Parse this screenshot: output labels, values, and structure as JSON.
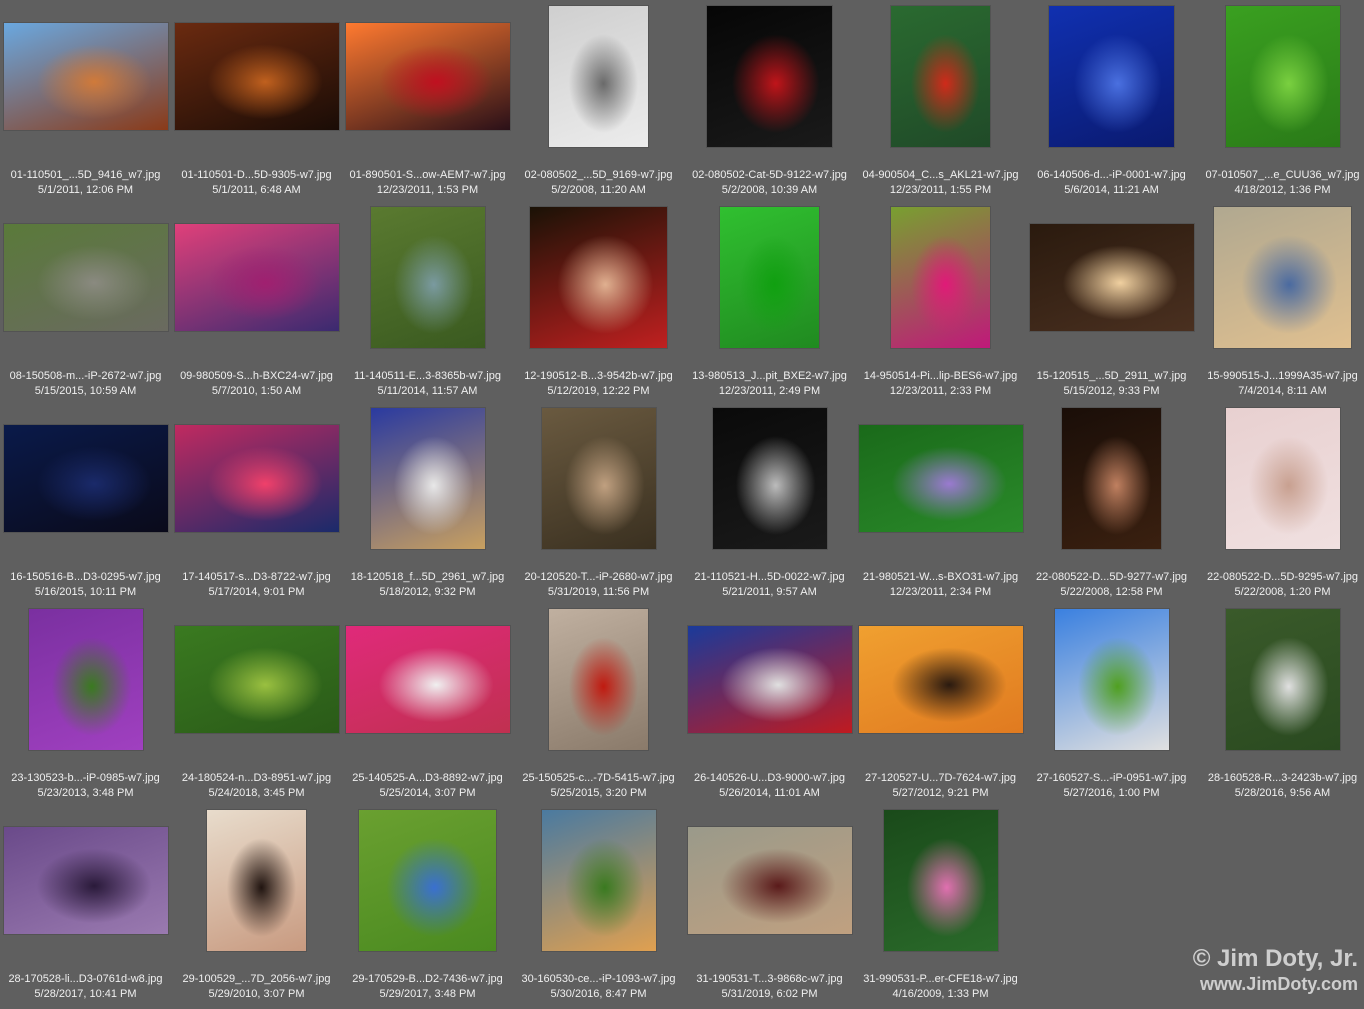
{
  "items": [
    {
      "name": "01-110501_...5D_9416_w7.jpg",
      "date": "5/1/2011, 12:06 PM",
      "shape": "l",
      "colors": [
        "#6aa8e0",
        "#d07a3a",
        "#8a3a18"
      ]
    },
    {
      "name": "01-110501-D...5D-9305-w7.jpg",
      "date": "5/1/2011, 6:48 AM",
      "shape": "l",
      "colors": [
        "#6a2a10",
        "#c0601e",
        "#1a0c06"
      ]
    },
    {
      "name": "01-890501-S...ow-AEM7-w7.jpg",
      "date": "12/23/2011, 1:53 PM",
      "shape": "l",
      "colors": [
        "#ff7a30",
        "#c01020",
        "#2a1018"
      ]
    },
    {
      "name": "02-080502_...5D_9169-w7.jpg",
      "date": "5/2/2008, 11:20 AM",
      "shape": "p",
      "colors": [
        "#cfcfcf",
        "#6a6a6a",
        "#ececec"
      ]
    },
    {
      "name": "02-080502-Cat-5D-9122-w7.jpg",
      "date": "5/2/2008, 10:39 AM",
      "shape": "s",
      "colors": [
        "#060606",
        "#c0141a",
        "#1a1a1a"
      ]
    },
    {
      "name": "04-900504_C...s_AKL21-w7.jpg",
      "date": "12/23/2011, 1:55 PM",
      "shape": "p",
      "colors": [
        "#2a6a30",
        "#d02a1a",
        "#204a28"
      ]
    },
    {
      "name": "06-140506-d...-iP-0001-w7.jpg",
      "date": "5/6/2014, 11:21 AM",
      "shape": "s",
      "colors": [
        "#1030b0",
        "#4a70e0",
        "#0a1a70"
      ]
    },
    {
      "name": "07-010507_...e_CUU36_w7.jpg",
      "date": "4/18/2012, 1:36 PM",
      "shape": "q",
      "colors": [
        "#3aa020",
        "#7ad040",
        "#2a7a18"
      ]
    },
    {
      "name": "08-150508-m...-iP-2672-w7.jpg",
      "date": "5/15/2015, 10:59 AM",
      "shape": "l",
      "colors": [
        "#5a7a3a",
        "#8a8a80",
        "#6a6a60"
      ]
    },
    {
      "name": "09-980509-S...h-BXC24-w7.jpg",
      "date": "5/7/2010, 1:50 AM",
      "shape": "l",
      "colors": [
        "#e0407a",
        "#a02070",
        "#3a2a70"
      ]
    },
    {
      "name": "11-140511-E...3-8365b-w7.jpg",
      "date": "5/11/2014, 11:57 AM",
      "shape": "q",
      "colors": [
        "#5a7a30",
        "#7a9aa0",
        "#3a5a20"
      ]
    },
    {
      "name": "12-190512-B...3-9542b-w7.jpg",
      "date": "5/12/2019, 12:22 PM",
      "shape": "r",
      "colors": [
        "#1a1206",
        "#e0b090",
        "#c02020"
      ]
    },
    {
      "name": "13-980513_J...pit_BXE2-w7.jpg",
      "date": "12/23/2011, 2:49 PM",
      "shape": "p",
      "colors": [
        "#30c030",
        "#10a010",
        "#208a20"
      ]
    },
    {
      "name": "14-950514-Pi...lip-BES6-w7.jpg",
      "date": "12/23/2011, 2:33 PM",
      "shape": "p",
      "colors": [
        "#78a030",
        "#e01a78",
        "#c0187a"
      ]
    },
    {
      "name": "15-120515_...5D_2911_w7.jpg",
      "date": "5/15/2012, 9:33 PM",
      "shape": "l",
      "colors": [
        "#2a1a0e",
        "#f0d0a0",
        "#4a3020"
      ]
    },
    {
      "name": "15-990515-J...1999A35-w7.jpg",
      "date": "7/4/2014, 8:11 AM",
      "shape": "r",
      "colors": [
        "#b0a890",
        "#4a6aa0",
        "#e0c090"
      ]
    },
    {
      "name": "16-150516-B...D3-0295-w7.jpg",
      "date": "5/16/2015, 10:11 PM",
      "shape": "l",
      "colors": [
        "#0a1a4a",
        "#1a2a6a",
        "#0a0a1a"
      ]
    },
    {
      "name": "17-140517-s...D3-8722-w7.jpg",
      "date": "5/17/2014, 9:01 PM",
      "shape": "l",
      "colors": [
        "#c02a60",
        "#f0406a",
        "#1a2a6a"
      ]
    },
    {
      "name": "18-120518_f...5D_2961_w7.jpg",
      "date": "5/18/2012, 9:32 PM",
      "shape": "q",
      "colors": [
        "#2a3aa0",
        "#e8e8e8",
        "#c8a060"
      ]
    },
    {
      "name": "20-120520-T...-iP-2680-w7.jpg",
      "date": "5/31/2019, 11:56 PM",
      "shape": "q",
      "colors": [
        "#6a5a40",
        "#c0a080",
        "#3a3020"
      ]
    },
    {
      "name": "21-110521-H...5D-0022-w7.jpg",
      "date": "5/21/2011, 9:57 AM",
      "shape": "q",
      "colors": [
        "#0a0a0a",
        "#bcbcbc",
        "#1a1a1a"
      ]
    },
    {
      "name": "21-980521-W...s-BXO31-w7.jpg",
      "date": "12/23/2011, 2:34 PM",
      "shape": "l",
      "colors": [
        "#1a6a1a",
        "#9a7ad0",
        "#2a8a2a"
      ]
    },
    {
      "name": "22-080522-D...5D-9277-w7.jpg",
      "date": "5/22/2008, 12:58 PM",
      "shape": "p",
      "colors": [
        "#1a0e08",
        "#c08060",
        "#3a2010"
      ]
    },
    {
      "name": "22-080522-D...5D-9295-w7.jpg",
      "date": "5/22/2008, 1:20 PM",
      "shape": "q",
      "colors": [
        "#e8d0d0",
        "#c8a090",
        "#f0e0e0"
      ]
    },
    {
      "name": "23-130523-b...-iP-0985-w7.jpg",
      "date": "5/23/2013, 3:48 PM",
      "shape": "q",
      "colors": [
        "#7a30a0",
        "#3a7a20",
        "#a040c0"
      ]
    },
    {
      "name": "24-180524-n...D3-8951-w7.jpg",
      "date": "5/24/2018, 3:45 PM",
      "shape": "l",
      "colors": [
        "#3a7a20",
        "#9ac040",
        "#2a5a18"
      ]
    },
    {
      "name": "25-140525-A...D3-8892-w7.jpg",
      "date": "5/25/2014, 3:07 PM",
      "shape": "l",
      "colors": [
        "#e02a7a",
        "#f0f0f0",
        "#c03050"
      ]
    },
    {
      "name": "25-150525-c...-7D-5415-w7.jpg",
      "date": "5/25/2015, 3:20 PM",
      "shape": "p",
      "colors": [
        "#c0b0a0",
        "#c01a10",
        "#8a7a6a"
      ]
    },
    {
      "name": "26-140526-U...D3-9000-w7.jpg",
      "date": "5/26/2014, 11:01 AM",
      "shape": "l",
      "colors": [
        "#1a3a9a",
        "#e0e0e0",
        "#c01a20"
      ]
    },
    {
      "name": "27-120527-U...7D-7624-w7.jpg",
      "date": "5/27/2012, 9:21 PM",
      "shape": "l",
      "colors": [
        "#f0a030",
        "#2a1a10",
        "#e07a20"
      ]
    },
    {
      "name": "27-160527-S...-iP-0951-w7.jpg",
      "date": "5/27/2016, 1:00 PM",
      "shape": "q",
      "colors": [
        "#3a80e0",
        "#50a020",
        "#e0e0e0"
      ]
    },
    {
      "name": "28-160528-R...3-2423b-w7.jpg",
      "date": "5/28/2016, 9:56 AM",
      "shape": "q",
      "colors": [
        "#3a5a2a",
        "#e0e0e0",
        "#2a4a20"
      ]
    },
    {
      "name": "28-170528-li...D3-0761d-w8.jpg",
      "date": "5/28/2017, 10:41 PM",
      "shape": "l",
      "colors": [
        "#6a4a8a",
        "#2a1a3a",
        "#9a7ab0"
      ]
    },
    {
      "name": "29-100529_...7D_2056-w7.jpg",
      "date": "5/29/2010, 3:07 PM",
      "shape": "p",
      "colors": [
        "#e8dccc",
        "#201410",
        "#c89a80"
      ]
    },
    {
      "name": "29-170529-B...D2-7436-w7.jpg",
      "date": "5/29/2017, 3:48 PM",
      "shape": "r",
      "colors": [
        "#6aa030",
        "#3a70d0",
        "#4a8a20"
      ]
    },
    {
      "name": "30-160530-ce...-iP-1093-w7.jpg",
      "date": "5/30/2016, 8:47 PM",
      "shape": "q",
      "colors": [
        "#4a7aa0",
        "#3a7a20",
        "#e0a050"
      ]
    },
    {
      "name": "31-190531-T...3-9868c-w7.jpg",
      "date": "5/31/2019, 6:02 PM",
      "shape": "l",
      "colors": [
        "#9a9a8a",
        "#5a1a1a",
        "#c0a080"
      ]
    },
    {
      "name": "31-990531-P...er-CFE18-w7.jpg",
      "date": "4/16/2009, 1:33 PM",
      "shape": "q",
      "colors": [
        "#1a4a1a",
        "#e070b0",
        "#2a6a2a"
      ]
    }
  ],
  "watermark": {
    "line1": "© Jim Doty, Jr.",
    "line2": "www.JimDoty.com"
  }
}
